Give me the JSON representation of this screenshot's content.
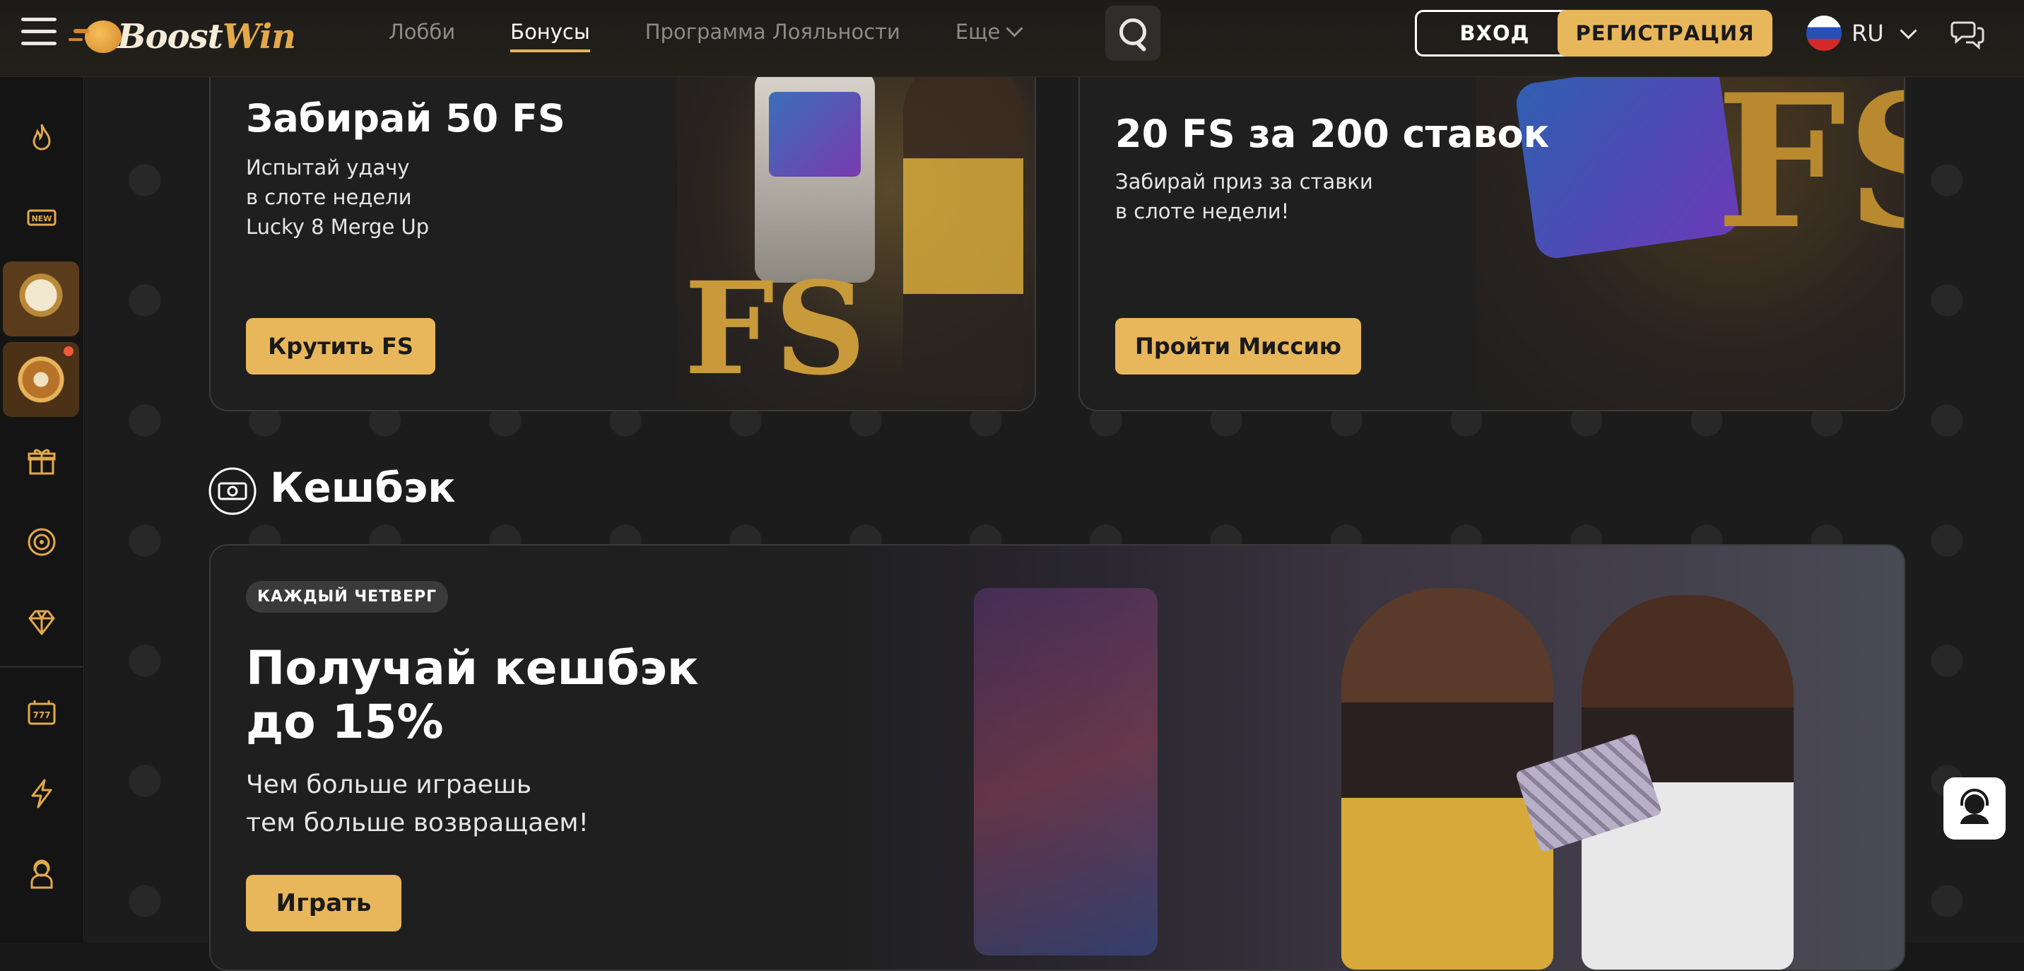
{
  "header": {
    "logo": {
      "part1": "Boost",
      "part2": "Win"
    },
    "nav": [
      {
        "label": "Лобби",
        "active": false
      },
      {
        "label": "Бонусы",
        "active": true
      },
      {
        "label": "Программа Лояльности",
        "active": false
      },
      {
        "label": "Еще",
        "active": false,
        "dropdown": true
      }
    ],
    "login_label": "ВХОД",
    "register_label": "РЕГИСТРАЦИЯ",
    "language": "RU"
  },
  "sidebar": {
    "icons": [
      "fire-icon",
      "new-icon",
      "gift-box-icon",
      "wheel-of-fortune-icon",
      "present-icon",
      "target-icon",
      "diamond-icon",
      "slots-777-icon",
      "lightning-icon",
      "support-agent-icon"
    ]
  },
  "cards": {
    "fs_card": {
      "title": "Забирай 50 FS",
      "text_line1": "Испытай удачу",
      "text_line2": "в слоте недели",
      "text_line3": "Lucky 8 Merge Up",
      "button": "Крутить FS"
    },
    "mission_card": {
      "title": "20 FS за 200 ставок",
      "text_line1": "Забирай приз за ставки",
      "text_line2": "в слоте недели!",
      "button": "Пройти Миссию"
    }
  },
  "cashback": {
    "section_title": "Кешбэк",
    "badge": "КАЖДЫЙ ЧЕТВЕРГ",
    "title_line1": "Получай кешбэк",
    "title_line2": "до 15%",
    "text_line1": "Чем больше играешь",
    "text_line2": "тем больше возвращаем!",
    "button": "Играть"
  },
  "colors": {
    "accent": "#e8b75c",
    "background": "#1c1c1c",
    "card": "#1f1f1f"
  }
}
